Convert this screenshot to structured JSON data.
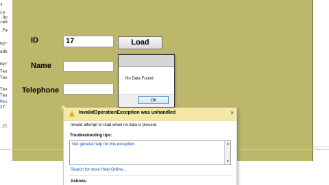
{
  "editor": {
    "code_lines": [
      "s",
      "co",
      ".Op",
      "cmd",
      ".Pa",
      "myr",
      "ade",
      "myr",
      "Tex",
      "Tex",
      "Tex",
      "Tex",
      "Mes",
      "If",
      ".Cl"
    ]
  },
  "form": {
    "background_color": "#bdb76b",
    "id_label": "ID",
    "id_value": "17",
    "name_label": "Name",
    "name_value": "",
    "telephone_label": "Telephone",
    "telephone_value": "",
    "load_button": "Load"
  },
  "message_box": {
    "text": "No Data Found",
    "ok_button": "OK"
  },
  "exception_helper": {
    "title": "InvalidOperationException was unhandled",
    "message": "Invalid attempt to read when no data is present.",
    "tips_heading": "Troubleshooting tips:",
    "tip_link": "Get general help for this exception.",
    "search_link": "Search for more Help Online...",
    "actions_heading": "Actions:",
    "close_glyph": "×",
    "icon": "warning-icon"
  }
}
